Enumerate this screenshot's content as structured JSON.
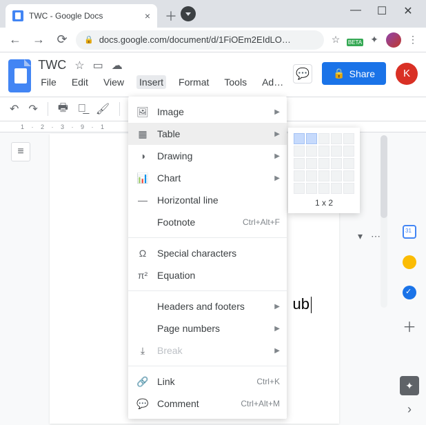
{
  "browser": {
    "tab_title": "TWC - Google Docs",
    "url": "docs.google.com/document/d/1FiOEm2EIdLO…",
    "beta_label": "BETA"
  },
  "docs": {
    "title": "TWC",
    "menus": [
      "File",
      "Edit",
      "View",
      "Insert",
      "Format",
      "Tools",
      "Ad…"
    ],
    "active_menu_index": 3,
    "share_label": "Share",
    "profile_initial": "K"
  },
  "ruler_text": "1  ·  2  ·  3  ·                                 9   ·  1",
  "insert_menu": [
    {
      "icon": "🖼",
      "label": "Image",
      "arrow": true
    },
    {
      "icon": "▦",
      "label": "Table",
      "arrow": true,
      "highlighted": true
    },
    {
      "icon": "◑",
      "label": "Drawing",
      "arrow": true
    },
    {
      "icon": "📊",
      "label": "Chart",
      "arrow": true
    },
    {
      "icon": "—",
      "label": "Horizontal line"
    },
    {
      "icon": "",
      "label": "Footnote",
      "shortcut": "Ctrl+Alt+F"
    },
    {
      "sep": true
    },
    {
      "icon": "Ω",
      "label": "Special characters"
    },
    {
      "icon": "π²",
      "label": "Equation"
    },
    {
      "sep": true
    },
    {
      "icon": "",
      "label": "Headers and footers",
      "arrow": true
    },
    {
      "icon": "",
      "label": "Page numbers",
      "arrow": true
    },
    {
      "icon": "⤓",
      "label": "Break",
      "arrow": true,
      "disabled": true
    },
    {
      "sep": true
    },
    {
      "icon": "🔗",
      "label": "Link",
      "shortcut": "Ctrl+K"
    },
    {
      "icon": "💬",
      "label": "Comment",
      "shortcut": "Ctrl+Alt+M"
    }
  ],
  "table_picker": {
    "rows": 5,
    "cols": 5,
    "sel_rows": 1,
    "sel_cols": 2,
    "label": "1 x 2"
  },
  "page_text": "ub"
}
